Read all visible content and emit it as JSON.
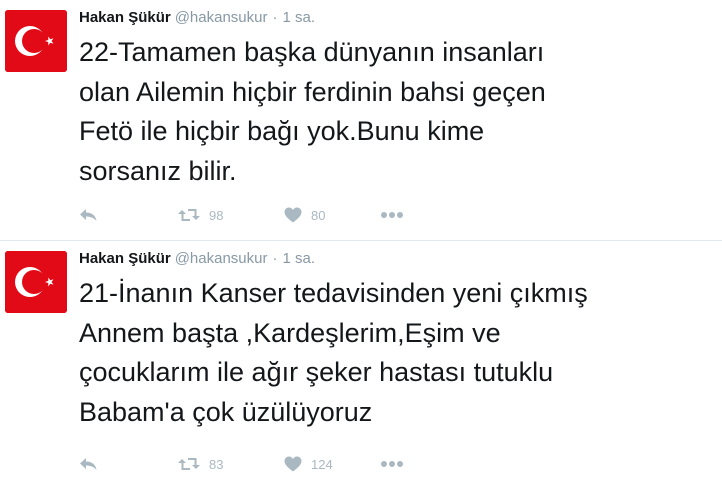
{
  "colors": {
    "name": "#14171a",
    "muted": "#8899a6",
    "action": "#aab8c2",
    "avatar_red": "#e30a17"
  },
  "tweets": [
    {
      "author_name": "Hakan Şükür",
      "handle": "@hakansukur",
      "separator": "·",
      "time": "1 sa.",
      "text": "22-Tamamen başka dünyanın insanları\nolan Ailemin hiçbir ferdinin bahsi geçen\nFetö ile hiçbir bağı yok.Bunu kime\nsorsanız bilir.",
      "retweets": "98",
      "likes": "80",
      "icons": [
        "reply-icon",
        "retweet-icon",
        "heart-icon",
        "more-icon"
      ]
    },
    {
      "author_name": "Hakan Şükür",
      "handle": "@hakansukur",
      "separator": "·",
      "time": "1 sa.",
      "text": "21-İnanın Kanser tedavisinden yeni çıkmış\nAnnem başta ,Kardeşlerim,Eşim ve\nçocuklarım ile ağır şeker hastası  tutuklu\nBabam'a çok üzülüyoruz",
      "retweets": "83",
      "likes": "124",
      "icons": [
        "reply-icon",
        "retweet-icon",
        "heart-icon",
        "more-icon"
      ]
    }
  ]
}
